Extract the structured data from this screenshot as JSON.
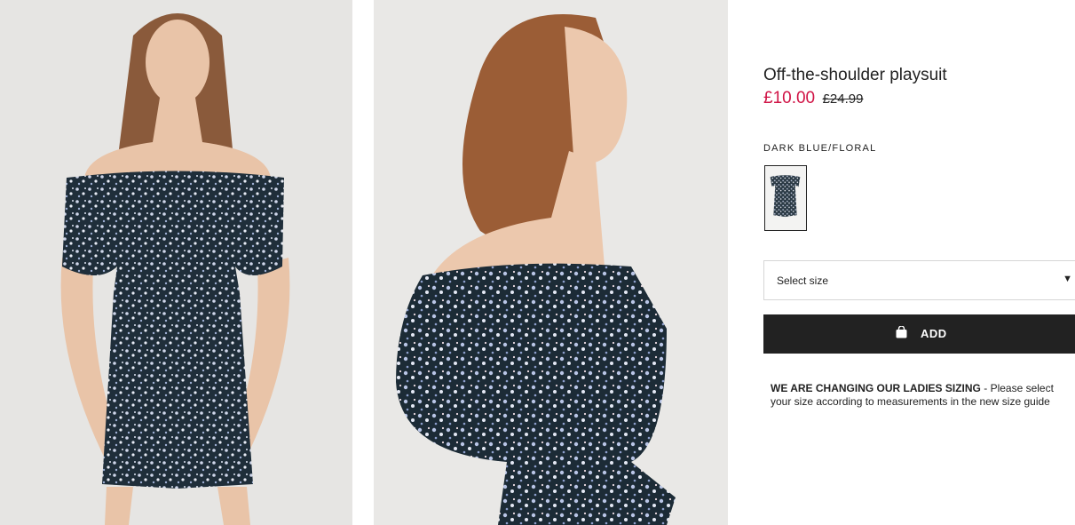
{
  "product": {
    "title": "Off-the-shoulder playsuit",
    "price_sale": "£10.00",
    "price_original": "£24.99",
    "color_name": "DARK BLUE/FLORAL"
  },
  "size_select": {
    "label": "Select size",
    "icon": "chevron-down-icon"
  },
  "add_button": {
    "label": "ADD",
    "icon": "shopping-bag-icon"
  },
  "notice": {
    "heading": "WE ARE CHANGING OUR LADIES SIZING",
    "text": " - Please select your size according to measurements in the new size guide"
  },
  "colors": {
    "sale": "#d01345",
    "button_bg": "#222222",
    "text": "#222222",
    "fabric": "#1f2e3a"
  }
}
